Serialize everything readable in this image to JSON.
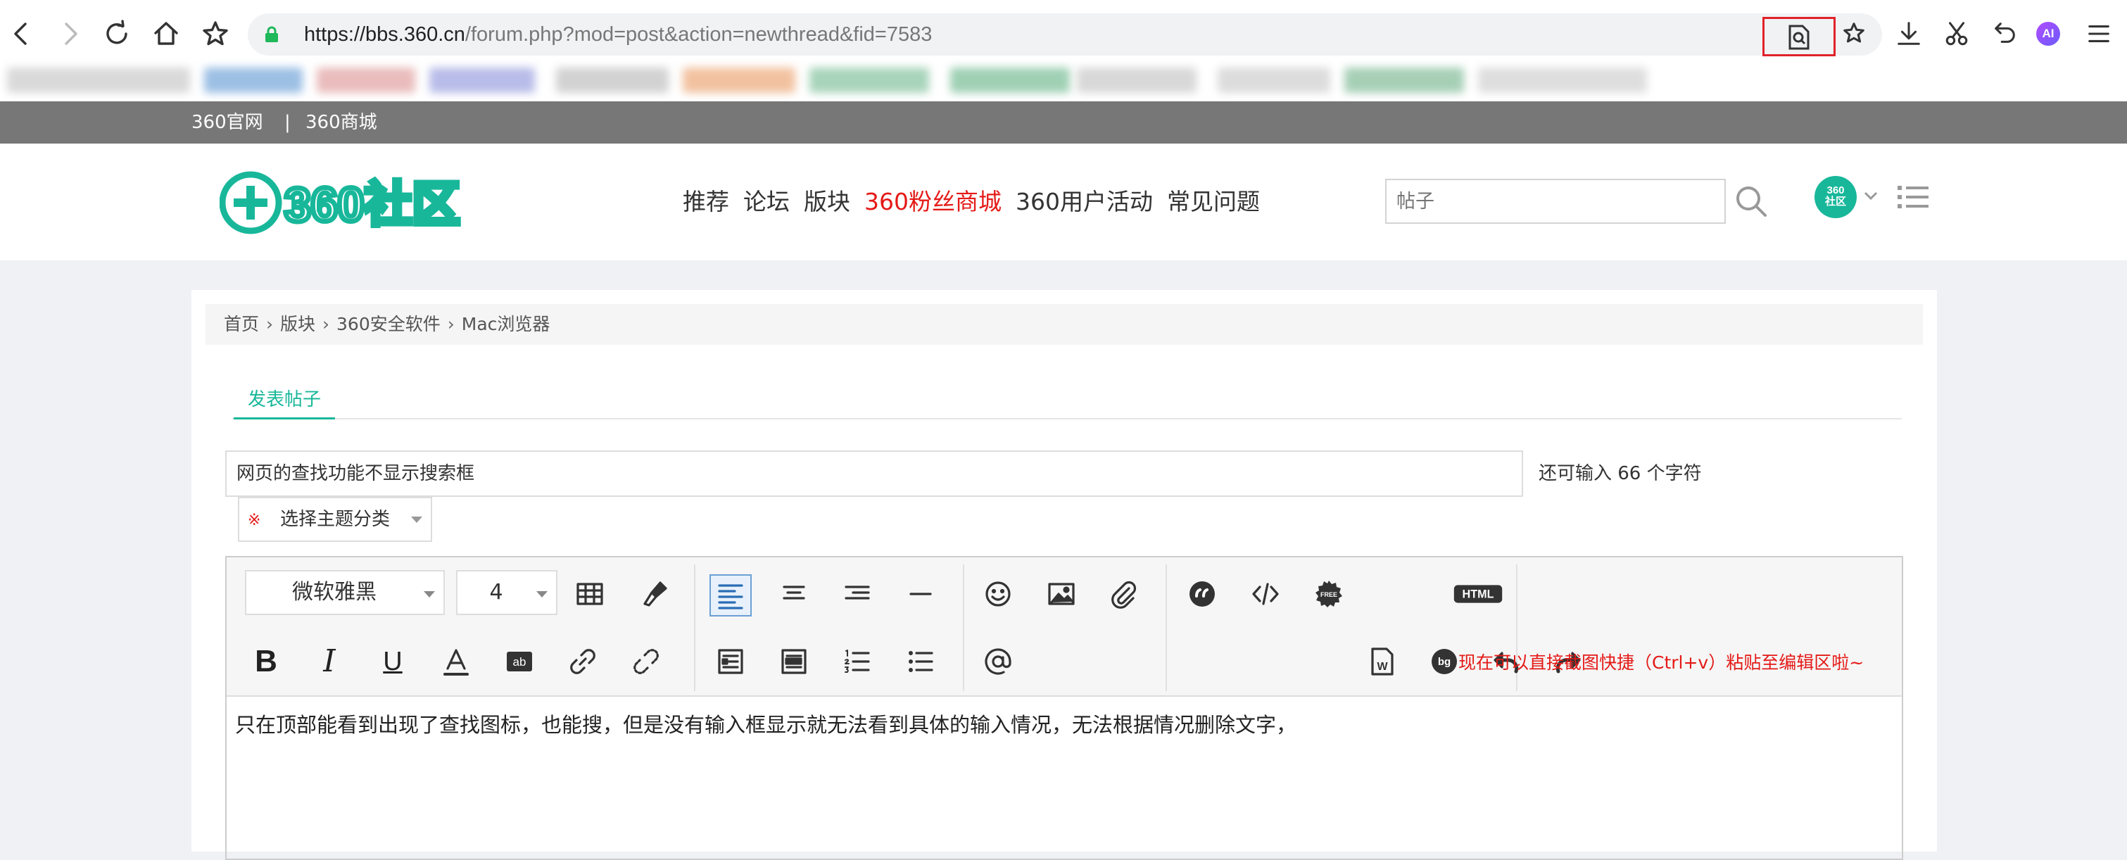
{
  "browser": {
    "url_host": "https://bbs.360.cn",
    "url_path": "/forum.php?mod=post&action=newthread&fid=7583"
  },
  "site_topbar": {
    "link_official": "360官网",
    "separator": "|",
    "link_mall": "360商城"
  },
  "header": {
    "logo_text": "360社区",
    "nav": [
      "推荐",
      "论坛",
      "版块",
      "360粉丝商城",
      "360用户活动",
      "常见问题"
    ],
    "search_placeholder": "帖子",
    "avatar_label_top": "360",
    "avatar_label_bottom": "社区",
    "accent_color": "#18b79a",
    "hot_color": "#e41a17"
  },
  "breadcrumb": [
    "首页",
    "版块",
    "360安全软件",
    "Mac浏览器"
  ],
  "breadcrumb_sep": "›",
  "post": {
    "tab_label": "发表帖子",
    "subject_value": "网页的查找功能不显示搜索框",
    "remaining_text": "还可输入 66 个字符",
    "required_mark": "※",
    "type_select_label": "选择主题分类"
  },
  "editor": {
    "font_family_value": "微软雅黑",
    "font_size_value": "4",
    "paste_hint": "现在可以直接截图快捷（Ctrl+v）粘贴至编辑区啦~",
    "content": "只在顶部能看到出现了查找图标，也能搜，但是没有输入框显示就无法看到具体的输入情况，无法根据情况删除文字，",
    "icon_labels": {
      "free": "FREE",
      "html": "HTML",
      "bg": "bg",
      "word": "W",
      "ab": "ab"
    }
  }
}
